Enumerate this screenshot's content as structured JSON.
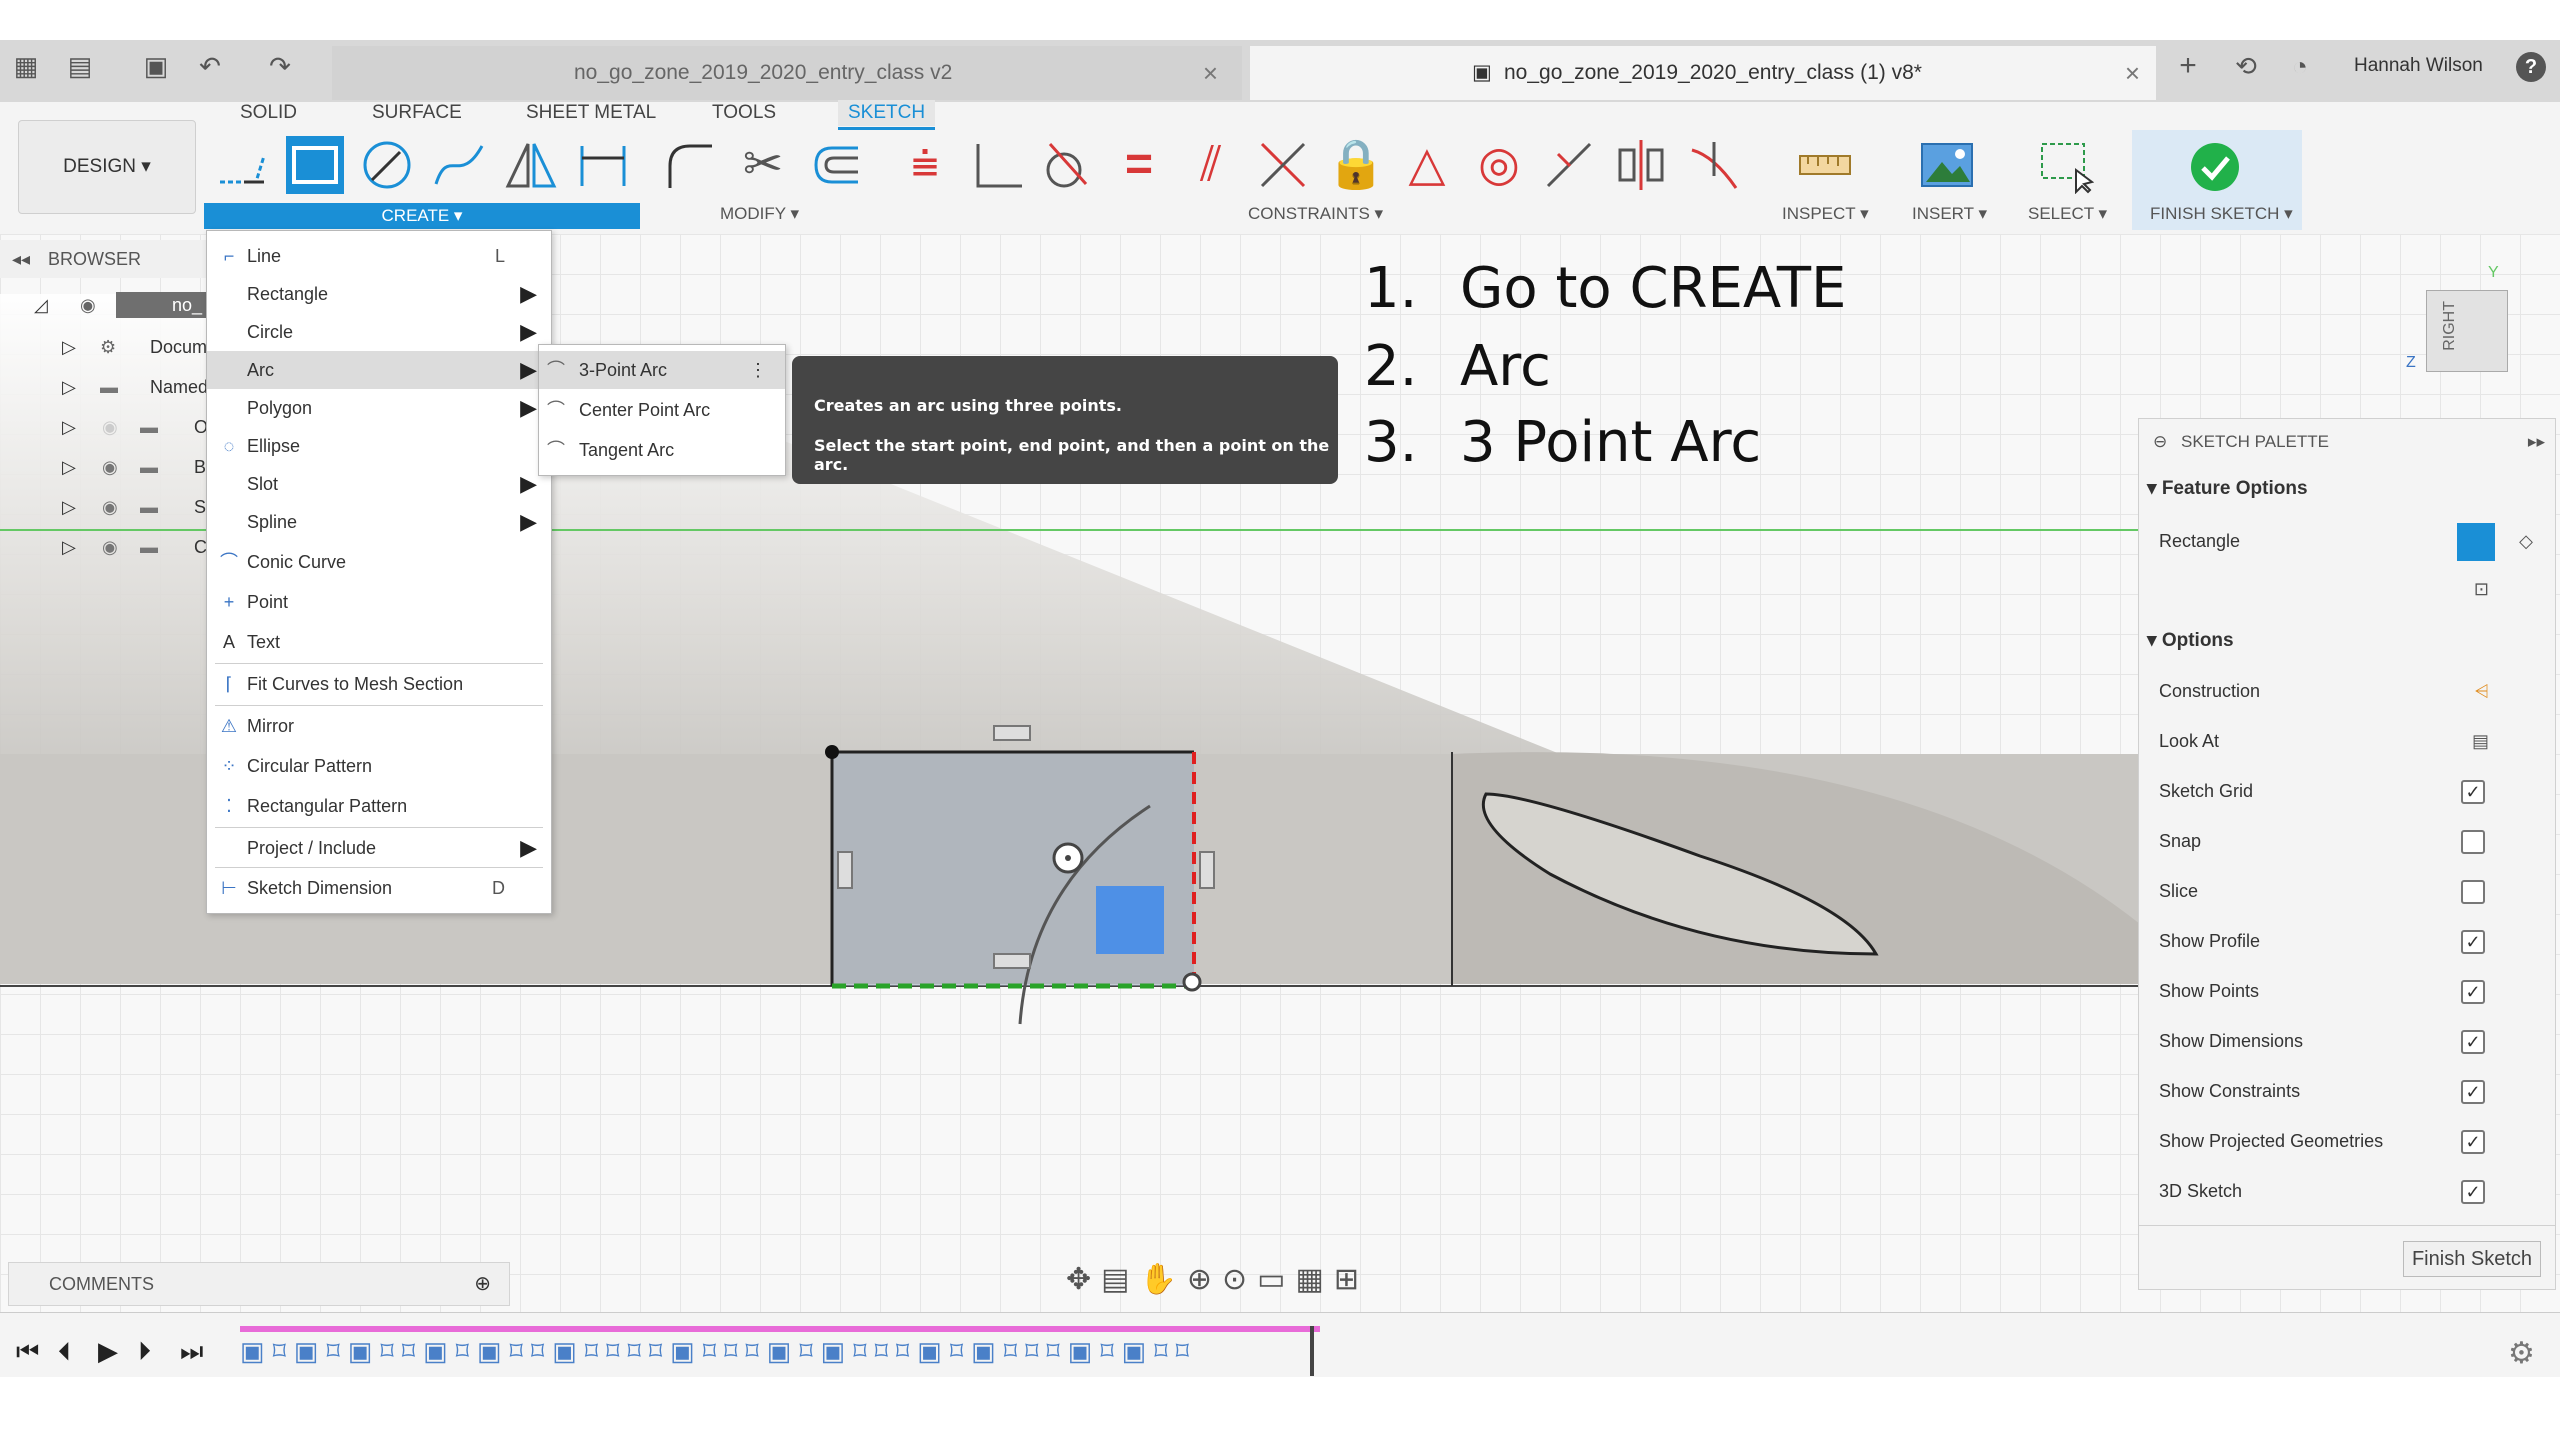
{
  "app": {
    "grid_label": "▦",
    "file_label": "▤",
    "save_label": "▣",
    "undo_label": "↶",
    "redo_label": "↷"
  },
  "tabs": [
    {
      "label": "no_go_zone_2019_2020_entry_class v2",
      "close": "×"
    },
    {
      "label": "no_go_zone_2019_2020_entry_class (1) v8*",
      "close": "×"
    }
  ],
  "user": {
    "name": "Hannah Wilson",
    "help": "?"
  },
  "workspace": {
    "label": "DESIGN ▾"
  },
  "ribbon_tabs": [
    "SOLID",
    "SURFACE",
    "SHEET METAL",
    "TOOLS",
    "SKETCH"
  ],
  "ribbon_groups": {
    "create": "CREATE ▾",
    "modify": "MODIFY ▾",
    "constraints": "CONSTRAINTS ▾",
    "inspect": "INSPECT ▾",
    "insert": "INSERT ▾",
    "select": "SELECT ▾",
    "finish": "FINISH SKETCH ▾"
  },
  "browser": {
    "title": "BROWSER",
    "rows": [
      "no_",
      "Docum",
      "Named",
      "O",
      "B",
      "S",
      "C"
    ]
  },
  "create_menu": {
    "items": [
      {
        "label": "Line",
        "shortcut": "L",
        "icon": "⌐",
        "submenu": false
      },
      {
        "label": "Rectangle",
        "shortcut": "",
        "icon": "",
        "submenu": true
      },
      {
        "label": "Circle",
        "shortcut": "",
        "icon": "",
        "submenu": true
      },
      {
        "label": "Arc",
        "shortcut": "",
        "icon": "",
        "submenu": true
      },
      {
        "label": "Polygon",
        "shortcut": "",
        "icon": "",
        "submenu": true
      },
      {
        "label": "Ellipse",
        "shortcut": "",
        "icon": "◌",
        "submenu": false
      },
      {
        "label": "Slot",
        "shortcut": "",
        "icon": "",
        "submenu": true
      },
      {
        "label": "Spline",
        "shortcut": "",
        "icon": "",
        "submenu": true
      },
      {
        "label": "Conic Curve",
        "shortcut": "",
        "icon": "⌒",
        "submenu": false
      },
      {
        "label": "Point",
        "shortcut": "",
        "icon": "+",
        "submenu": false
      },
      {
        "label": "Text",
        "shortcut": "",
        "icon": "A",
        "submenu": false
      },
      {
        "label": "Fit Curves to Mesh Section",
        "shortcut": "",
        "icon": "⌈",
        "submenu": false
      },
      {
        "label": "Mirror",
        "shortcut": "",
        "icon": "⚠",
        "submenu": false
      },
      {
        "label": "Circular Pattern",
        "shortcut": "",
        "icon": "⁘",
        "submenu": false
      },
      {
        "label": "Rectangular Pattern",
        "shortcut": "",
        "icon": "⁚",
        "submenu": false
      },
      {
        "label": "Project / Include",
        "shortcut": "",
        "icon": "",
        "submenu": true
      },
      {
        "label": "Sketch Dimension",
        "shortcut": "D",
        "icon": "⊢",
        "submenu": false
      }
    ],
    "arrow": "▶"
  },
  "arc_submenu": {
    "items": [
      {
        "label": "3-Point Arc",
        "icon": "⌒"
      },
      {
        "label": "Center Point Arc",
        "icon": "⌒"
      },
      {
        "label": "Tangent Arc",
        "icon": "⌒"
      }
    ],
    "more": "⋮"
  },
  "tooltip": {
    "line1": "Creates an arc using three points.",
    "line2": "Select the start point, end point, and then a point on the arc."
  },
  "instructions": [
    {
      "num": "1.",
      "text": "Go to CREATE"
    },
    {
      "num": "2.",
      "text": "Arc"
    },
    {
      "num": "3.",
      "text": "3 Point Arc"
    }
  ],
  "viewcube": {
    "face": "RIGHT",
    "axis_z": "Z",
    "axis_y": "Y"
  },
  "palette": {
    "title": "SKETCH PALETTE",
    "feature_options": "Feature Options",
    "rectangle": "Rectangle",
    "options": "Options",
    "construction": "Construction",
    "look_at": "Look At",
    "rows": [
      {
        "label": "Sketch Grid",
        "checked": true,
        "mark": "✓"
      },
      {
        "label": "Snap",
        "checked": false,
        "mark": ""
      },
      {
        "label": "Slice",
        "checked": false,
        "mark": ""
      },
      {
        "label": "Show Profile",
        "checked": true,
        "mark": "✓"
      },
      {
        "label": "Show Points",
        "checked": true,
        "mark": "✓"
      },
      {
        "label": "Show Dimensions",
        "checked": true,
        "mark": "✓"
      },
      {
        "label": "Show Constraints",
        "checked": true,
        "mark": "✓"
      },
      {
        "label": "Show Projected Geometries",
        "checked": true,
        "mark": "✓"
      },
      {
        "label": "3D Sketch",
        "checked": true,
        "mark": "✓"
      }
    ],
    "finish_button": "Finish Sketch"
  },
  "comments": {
    "label": "COMMENTS",
    "add": "⊕"
  },
  "colors": {
    "accent": "#1a8fd6",
    "finish_green": "#21b14a",
    "lock_red": "#d83838",
    "constraint_red": "#e02020"
  }
}
